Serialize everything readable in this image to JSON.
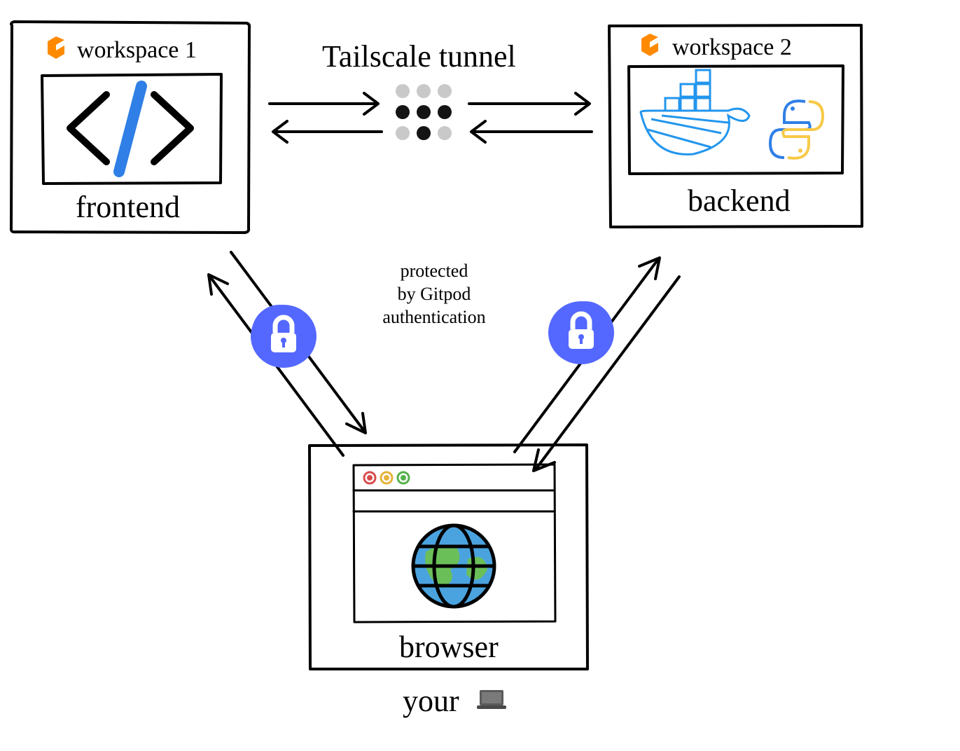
{
  "diagram": {
    "nodes": {
      "workspace1": {
        "title": "workspace 1",
        "cardLabel": "frontend",
        "icon": "gitpod-icon"
      },
      "workspace2": {
        "title": "workspace 2",
        "cardLabel": "backend",
        "icon": "gitpod-icon"
      },
      "client": {
        "cardLabel": "browser",
        "footer": "your "
      }
    },
    "connections": {
      "tunnel": {
        "label": "Tailscale tunnel",
        "hub": "tailscale-dots"
      },
      "authNote": {
        "line1": "protected",
        "line2": "by Gitpod",
        "line3": "authentication"
      }
    },
    "colors": {
      "gitpodOrange": "#ff8a00",
      "lockBlue": "#5468ff",
      "codeBlue": "#2f7fe6",
      "dockerBlue": "#2396ed",
      "pythonYellow": "#f7c948",
      "globeBlue": "#4aa3df",
      "globeGreen": "#6bbf59"
    }
  }
}
